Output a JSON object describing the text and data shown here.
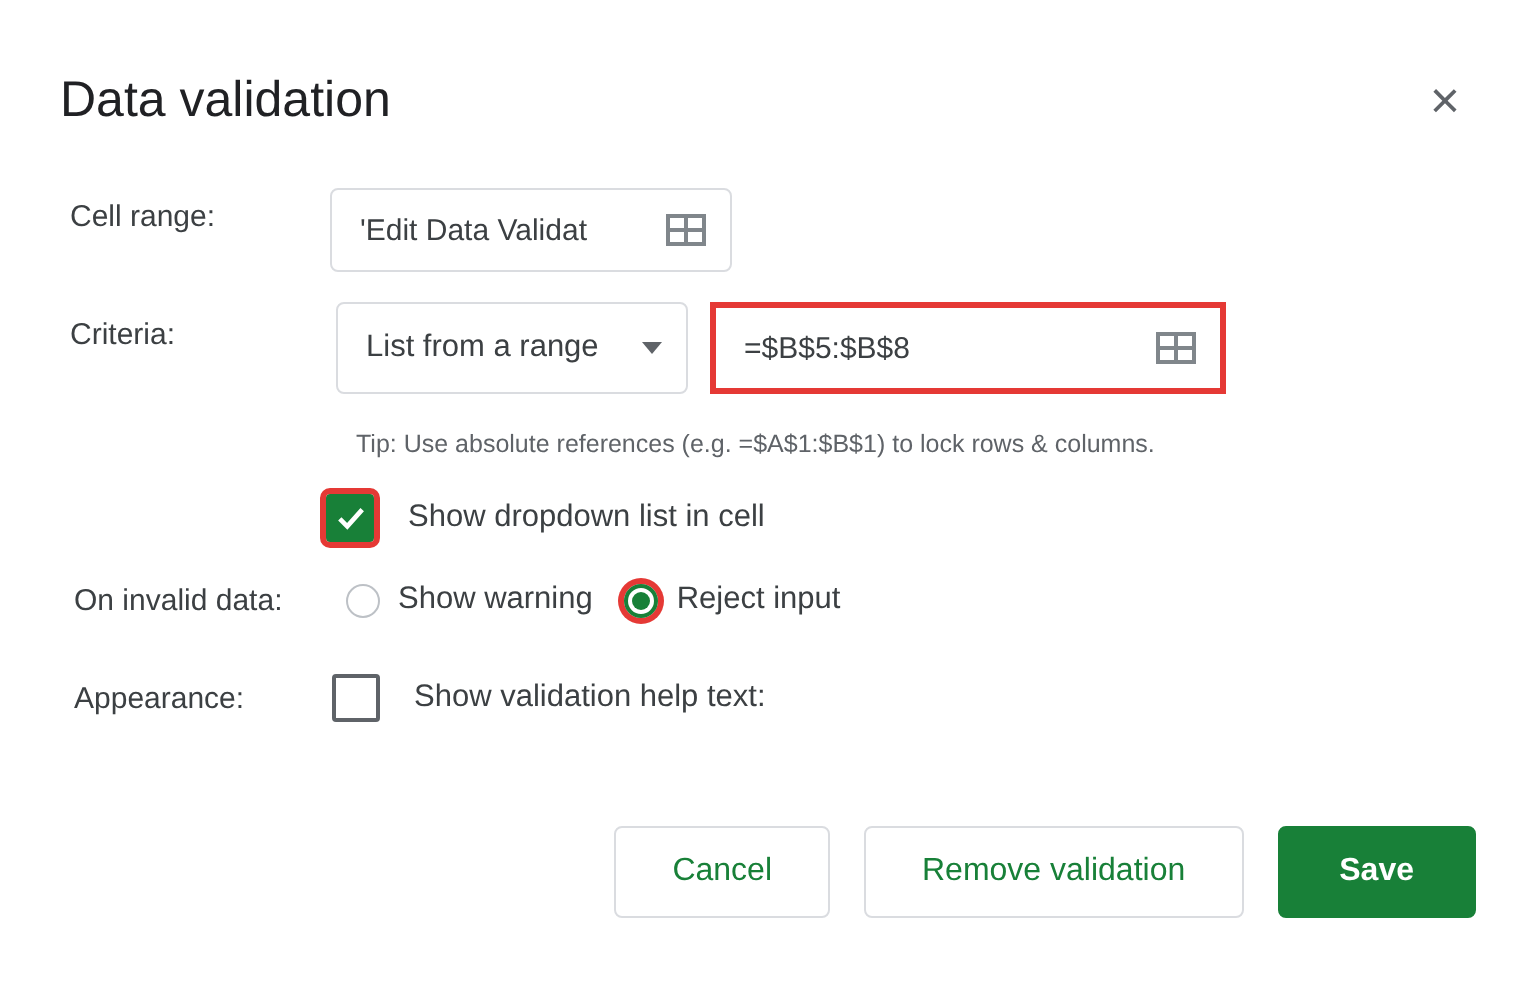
{
  "dialog": {
    "title": "Data validation",
    "close": "×"
  },
  "cell_range": {
    "label": "Cell range:",
    "value": "'Edit Data Validat"
  },
  "criteria": {
    "label": "Criteria:",
    "type": "List from a range",
    "range": "=$B$5:$B$8",
    "range_highlighted": true,
    "tip": "Tip: Use absolute references (e.g. =$A$1:$B$1) to lock rows & columns."
  },
  "dropdown_option": {
    "label": "Show dropdown list in cell",
    "checked": true,
    "highlighted": true
  },
  "invalid_data": {
    "label": "On invalid data:",
    "options": [
      {
        "label": "Show warning",
        "selected": false,
        "highlighted": false
      },
      {
        "label": "Reject input",
        "selected": true,
        "highlighted": true
      }
    ]
  },
  "appearance": {
    "label": "Appearance:",
    "help_text_option": {
      "label": "Show validation help text:",
      "checked": false
    }
  },
  "buttons": [
    {
      "label": "Cancel",
      "kind": "secondary"
    },
    {
      "label": "Remove validation",
      "kind": "secondary"
    },
    {
      "label": "Save",
      "kind": "primary"
    }
  ]
}
